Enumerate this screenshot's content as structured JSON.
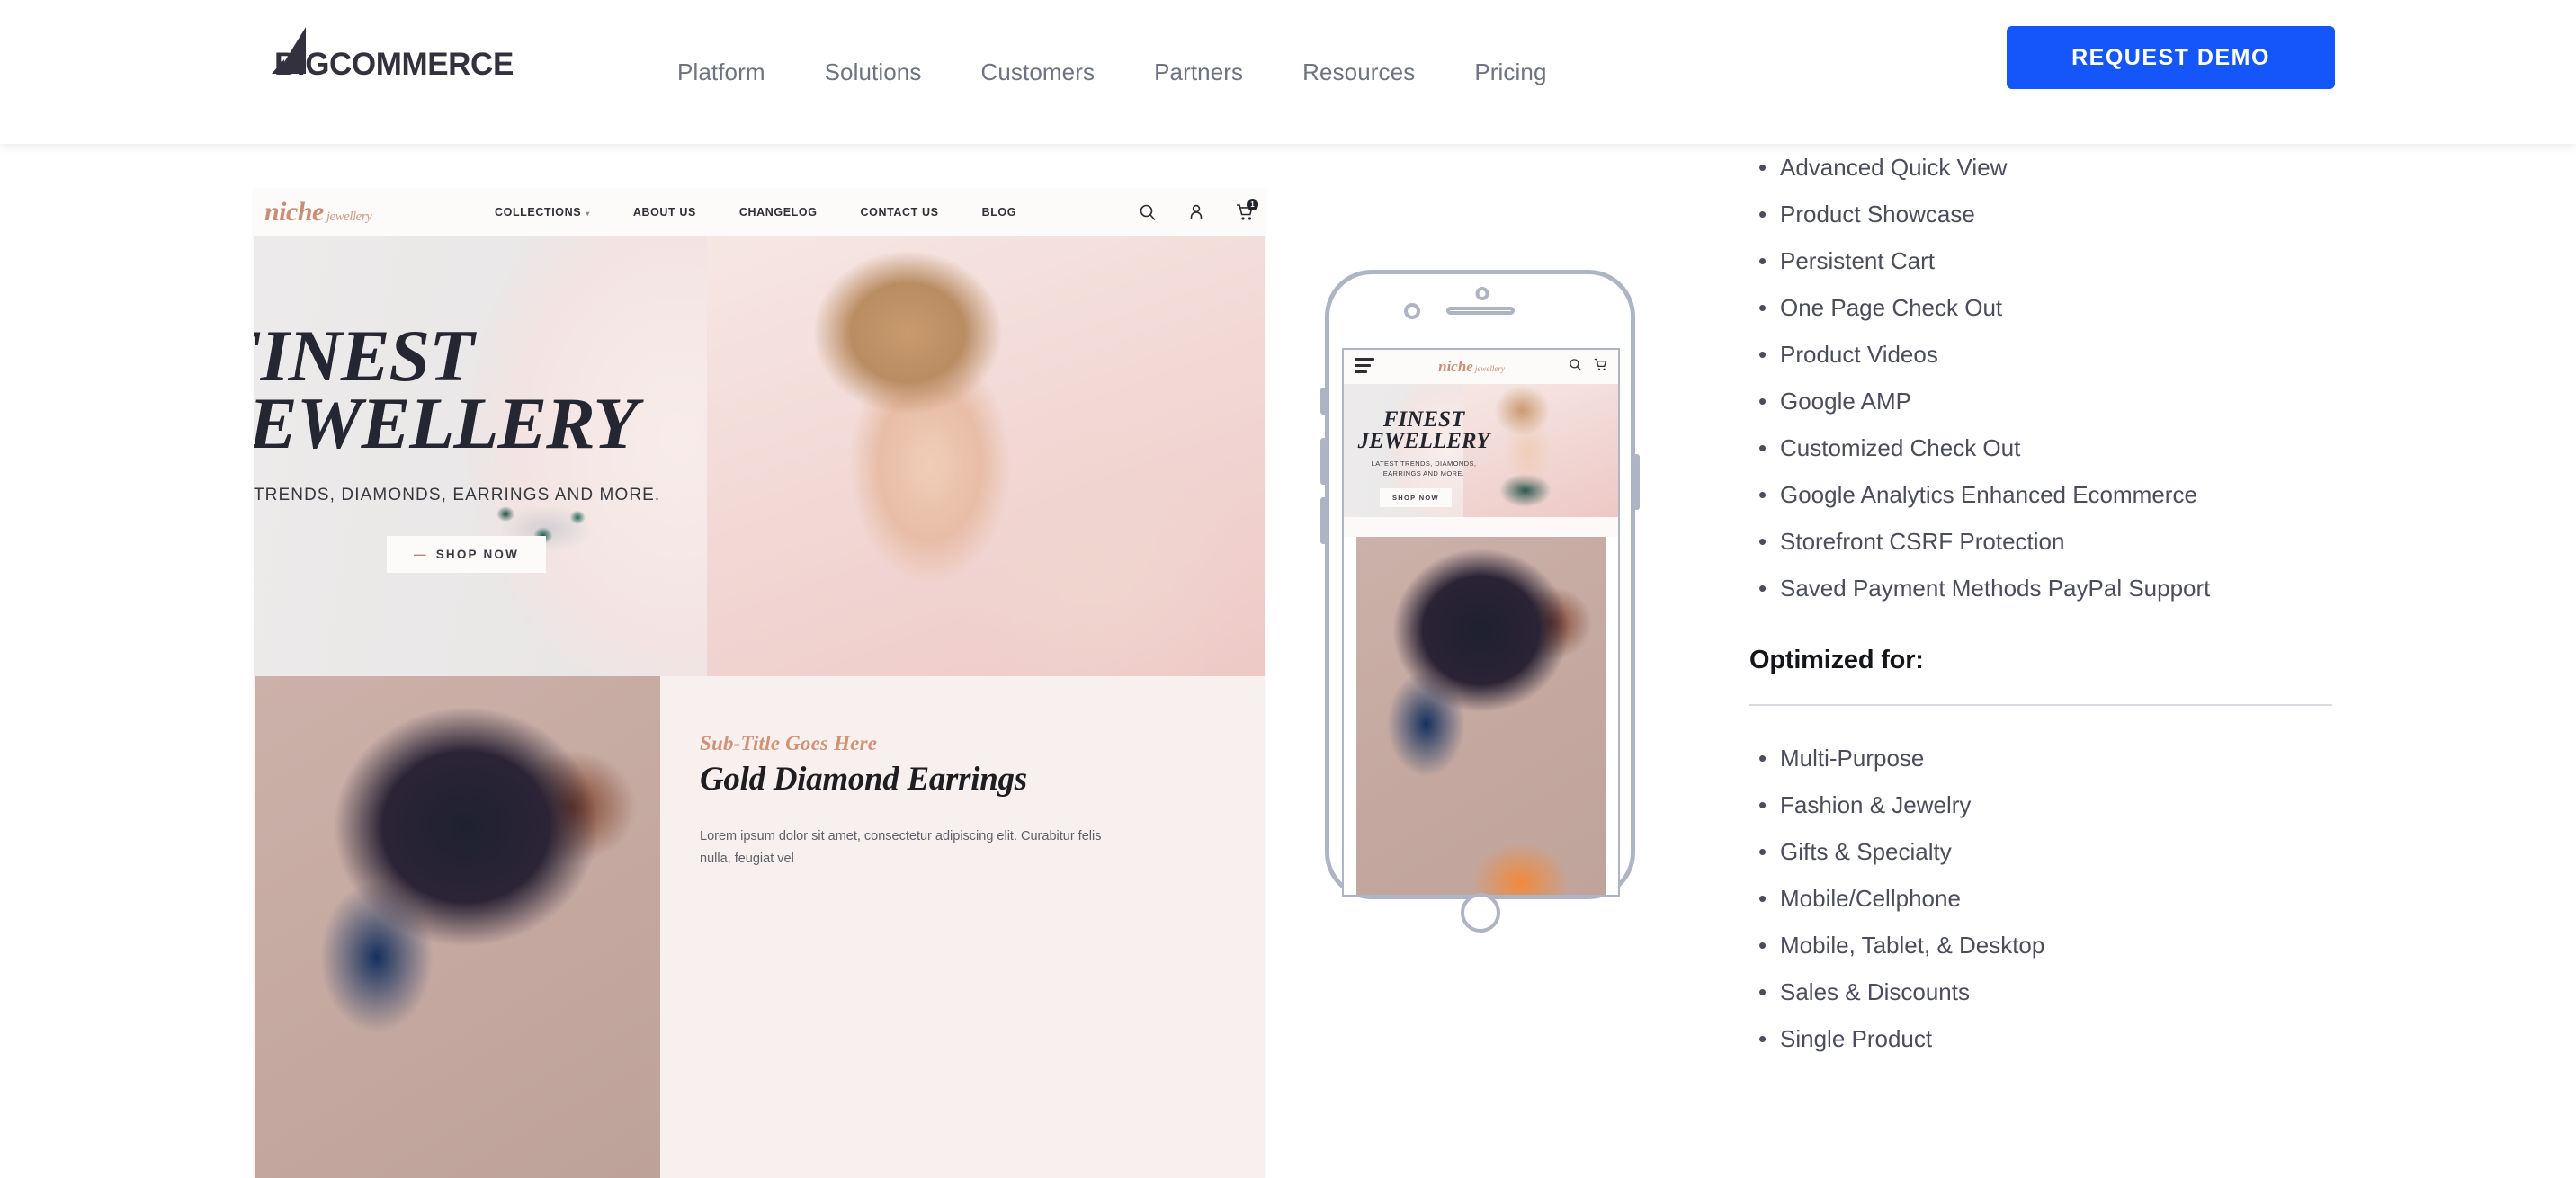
{
  "header": {
    "brand": {
      "wordmark": "COMMERCE",
      "mark_letters": "BIG"
    },
    "nav": [
      {
        "label": "Platform"
      },
      {
        "label": "Solutions"
      },
      {
        "label": "Customers"
      },
      {
        "label": "Partners"
      },
      {
        "label": "Resources"
      },
      {
        "label": "Pricing"
      }
    ],
    "cta": {
      "label": "REQUEST DEMO",
      "color": "#1456fa"
    }
  },
  "theme_preview": {
    "desktop": {
      "store_logo": {
        "name": "niche",
        "suffix": "jewellery"
      },
      "store_nav": [
        {
          "label": "COLLECTIONS",
          "has_caret": true
        },
        {
          "label": "ABOUT US",
          "has_caret": false
        },
        {
          "label": "CHANGELOG",
          "has_caret": false
        },
        {
          "label": "CONTACT US",
          "has_caret": false
        },
        {
          "label": "BLOG",
          "has_caret": false
        }
      ],
      "store_icons": [
        "search-icon",
        "account-icon",
        "cart-icon"
      ],
      "cart_count": "1",
      "hero": {
        "title": "FINEST\nJEWELLERY",
        "subtitle": "EST TRENDS, DIAMONDS, EARRINGS AND MORE.",
        "button": "SHOP NOW",
        "button_dash": "—"
      },
      "product": {
        "subtitle": "Sub-Title Goes Here",
        "title": "Gold Diamond Earrings",
        "description": "Lorem ipsum dolor sit amet, consectetur adipiscing elit. Curabitur felis nulla, feugiat vel"
      }
    },
    "mobile": {
      "store_logo": {
        "name": "niche",
        "suffix": "jewellery"
      },
      "store_icons": [
        "search-icon",
        "cart-icon"
      ],
      "menu_icon": "hamburger-icon",
      "hero": {
        "title": "FINEST\nJEWELLERY",
        "subtitle": "LATEST TRENDS, DIAMONDS,\nEARRINGS AND MORE.",
        "button": "SHOP NOW"
      }
    }
  },
  "features": {
    "items": [
      {
        "label": "Advanced Quick View"
      },
      {
        "label": "Product Showcase"
      },
      {
        "label": "Persistent Cart"
      },
      {
        "label": "One Page Check Out"
      },
      {
        "label": "Product Videos"
      },
      {
        "label": "Google AMP"
      },
      {
        "label": "Customized Check Out"
      },
      {
        "label": "Google Analytics Enhanced Ecommerce"
      },
      {
        "label": "Storefront CSRF Protection"
      },
      {
        "label": "Saved Payment Methods PayPal Support"
      }
    ]
  },
  "optimized": {
    "heading": "Optimized for:",
    "items": [
      {
        "label": "Multi-Purpose"
      },
      {
        "label": "Fashion & Jewelry"
      },
      {
        "label": "Gifts & Specialty"
      },
      {
        "label": "Mobile/Cellphone"
      },
      {
        "label": "Mobile, Tablet, & Desktop"
      },
      {
        "label": "Sales & Discounts"
      },
      {
        "label": "Single Product"
      }
    ]
  }
}
